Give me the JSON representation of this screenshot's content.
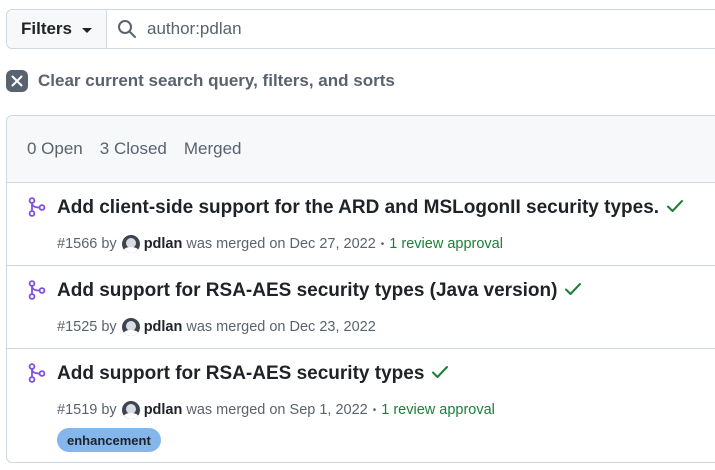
{
  "filter_bar": {
    "filters_label": "Filters",
    "search_query": "author:pdlan"
  },
  "clear_filters": {
    "label": "Clear current search query, filters, and sorts"
  },
  "tabs": [
    {
      "label": "0 Open"
    },
    {
      "label": "3 Closed"
    },
    {
      "label": "Merged"
    }
  ],
  "pull_requests": [
    {
      "title": "Add client-side support for the ARD and MSLogonII security types.",
      "number": "#1566",
      "by": "by",
      "author": "pdlan",
      "status_text": "was merged on Dec 27, 2022",
      "separator": "•",
      "approval": "1 review approval",
      "labels": []
    },
    {
      "title": "Add support for RSA-AES security types (Java version)",
      "number": "#1525",
      "by": "by",
      "author": "pdlan",
      "status_text": "was merged on Dec 23, 2022",
      "labels": []
    },
    {
      "title": "Add support for RSA-AES security types",
      "number": "#1519",
      "by": "by",
      "author": "pdlan",
      "status_text": "was merged on Sep 1, 2022",
      "separator": "•",
      "approval": "1 review approval",
      "labels": [
        "enhancement"
      ]
    }
  ],
  "colors": {
    "merged_purple": "#8250df",
    "check_green": "#1a7f37",
    "label_enhancement": "#84b6eb"
  },
  "icons": {
    "merged": "git-merge-icon",
    "check": "check-icon",
    "search": "search-icon",
    "clear": "x-icon"
  }
}
